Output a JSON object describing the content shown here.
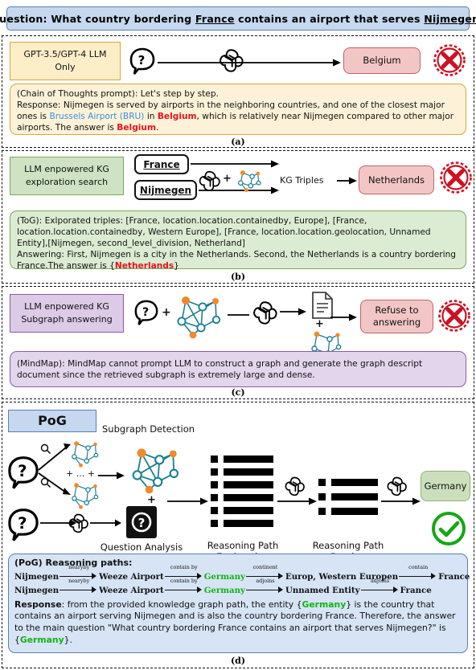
{
  "question": {
    "prefix": "Question:",
    "part1": " What country bordering ",
    "entity1": "France",
    "part2": " contains an airport that serves ",
    "entity2": "Nijmegen",
    "part3": "?"
  },
  "sections": [
    {
      "id": "a",
      "label": "(a)",
      "method_title": "GPT-3.5/GPT-4 LLM\nOnly",
      "answer": "Belgium",
      "verdict": "wrong",
      "explanation": {
        "prompt_label": "(Chain of Thoughts prompt): Let's step by step.",
        "response_label": "Response:",
        "response_text": " Nijmegen is served by airports in the neighboring countries, and one of the closest major ones is ",
        "highlight_blue": "Brussels Airport (BRU)",
        "mid_text": " in ",
        "highlight_red1": "Belgium",
        "tail_text": ", which is relatively near Nijmegen compared to other major airports. The answer is ",
        "highlight_red2": "Belgium",
        "period": "."
      }
    },
    {
      "id": "b",
      "label": "(b)",
      "method_title": "LLM enpowered KG\nexploration search",
      "entity_in_1": "France",
      "entity_in_2": "Nijmegen",
      "edge_label": "KG Triples",
      "answer": "Netherlands",
      "verdict": "wrong",
      "explanation": {
        "line1": "(ToG):  Exlporated triples: [France, location.location.containedby, Europe], [France, location.location.containedby, Western Europe], [France, location.location.geolocation, Unnamed Entity],[Nijmegen, second_level_division, Netherland]",
        "line2_pre": "Answering: First, Nijmegen is a city in the Netherlands. Second, the Netherlands is a country bordering France.The answer is {",
        "line2_red": "Netherlands",
        "line2_post": "}"
      }
    },
    {
      "id": "c",
      "label": "(c)",
      "method_title": "LLM enpowered KG\nSubgraph answering",
      "answer": "Refuse to\nanswering",
      "verdict": "wrong",
      "explanation": {
        "text": "(MindMap): MindMap cannot prompt LLM to construct a graph and generate the graph descript document since the retrieved subgraph is extremely large and dense."
      }
    },
    {
      "id": "d",
      "label": "(d)",
      "method_title": "PoG",
      "answer": "Germany",
      "verdict": "correct",
      "stage_labels": {
        "subgraph_detection": "Subgraph Detection",
        "question_analysis": "Question Analysis",
        "reasoning_path_exploration": "Reasoning Path\nExploration",
        "reasoning_path_pruning": "Reasoning Path\nPruning",
        "plus_dots": "+ ... +",
        "plus": "+"
      },
      "explanation": {
        "title": "(PoG) Reasoning paths:",
        "path1": [
          {
            "node": "Nijmegen",
            "color": "black"
          },
          {
            "rel": "nearyby"
          },
          {
            "node": "Weeze Airport",
            "color": "black"
          },
          {
            "rel": "contain by"
          },
          {
            "node": "Germany",
            "color": "green"
          },
          {
            "rel": "continent"
          },
          {
            "node": "Europ, Western Europen",
            "color": "black"
          },
          {
            "rel": "contain"
          },
          {
            "node": "France",
            "color": "black"
          }
        ],
        "path2": [
          {
            "node": "Nijmegen",
            "color": "black"
          },
          {
            "rel": "nearyby"
          },
          {
            "node": "Weeze Airport",
            "color": "black"
          },
          {
            "rel": "contain by"
          },
          {
            "node": "Germany",
            "color": "green"
          },
          {
            "rel": "adjoins"
          },
          {
            "node": "Unnamed Entity",
            "color": "black"
          },
          {
            "rel": "adjoins"
          },
          {
            "node": "France",
            "color": "black"
          }
        ],
        "response_label": "Response",
        "response_p1": ": from the provided knowledge graph path, the entity  {",
        "response_g1": "Germany",
        "response_p2": "} is the country that contains an airport serving Nijmegen and is also the country bordering France. Therefore, the answer to the main question \"What country bordering France contains an airport that serves Nijmegen?\" is {",
        "response_g2": "Germany",
        "response_p3": "}."
      }
    }
  ],
  "colors": {
    "question_bg": "#c5d8ef",
    "yellow": "#fdeec8",
    "green": "#cfe3c4",
    "purple": "#ddcae6",
    "blue": "#c5d8ef",
    "answer_red": "#f3c6c6",
    "answer_green": "#ccdfbc",
    "wrong_icon": "#cc1122",
    "correct_icon": "#14a814",
    "graph_node": "#1b7f94",
    "graph_accent": "#f08a2c"
  },
  "icons": {
    "wrong": "circle-x-icon",
    "correct": "circle-check-icon",
    "llm": "openai-logo-icon",
    "question": "question-bubble-icon",
    "graph": "knowledge-graph-icon",
    "document": "document-icon",
    "search": "magnifier-icon",
    "paths": "path-list-icon"
  }
}
